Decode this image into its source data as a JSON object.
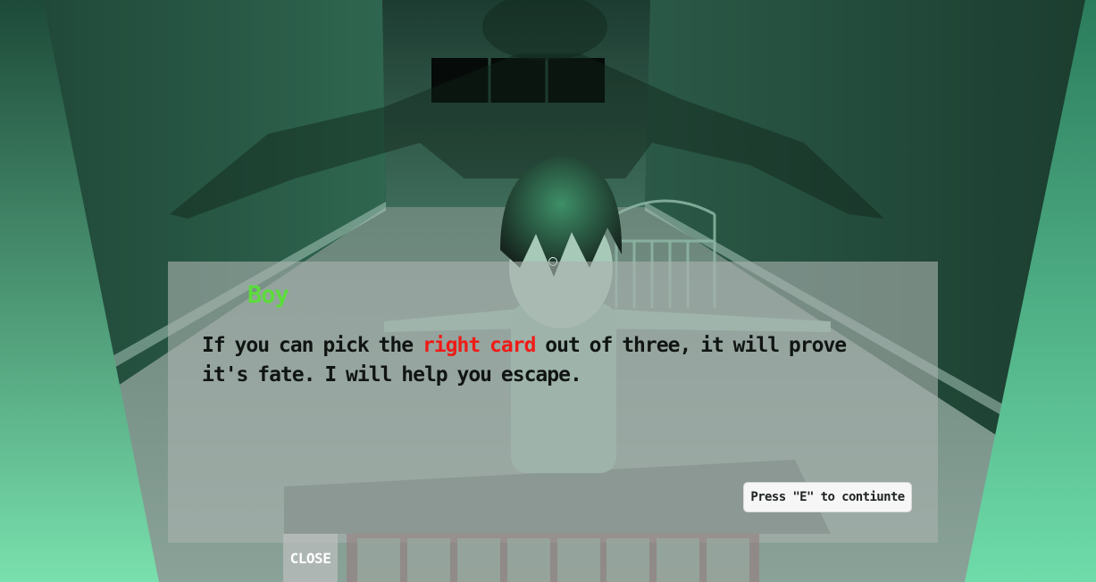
{
  "scene": {
    "wall_color": "#2c5a47",
    "light_color": "#77dba9",
    "floor_color": "#6f8a80"
  },
  "dialog": {
    "speaker": "Boy",
    "line1_before": "If you can pick the ",
    "line1_highlight": "right card",
    "line1_after": " out of three, it will prove",
    "line2": "it's fate. I will help you escape.",
    "continue_label": "Press \"E\" to contiunte",
    "speaker_color": "#5cdc3c",
    "highlight_color": "#ef1b17"
  },
  "hud": {
    "close_label": "CLOSE",
    "inventory_slots": [
      "",
      "",
      "",
      "",
      "",
      "",
      "",
      ""
    ]
  }
}
